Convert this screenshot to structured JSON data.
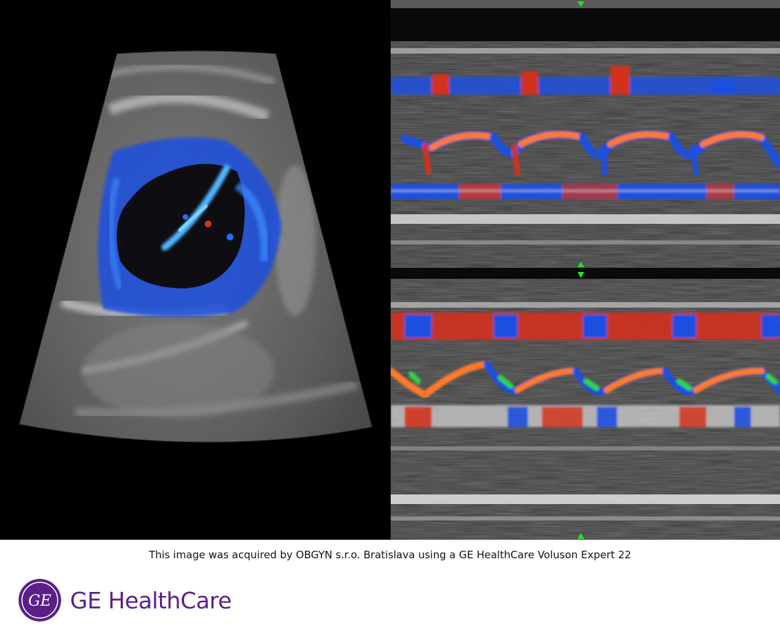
{
  "caption": "This image was acquired by OBGYN s.r.o. Bratislava using a GE HealthCare Voluson Expert 22",
  "brand": {
    "name": "GE HealthCare",
    "logo_icon": "ge-monogram-icon",
    "logo_text": "GE",
    "color": "#5b1f8a"
  },
  "colors": {
    "background_scan": "#000000",
    "background_page": "#ffffff",
    "doppler_blue": "#1e4fe0",
    "doppler_red": "#d2321e",
    "doppler_orange": "#ff7a2a",
    "doppler_green": "#2fd44a",
    "marker_green": "#22e02a"
  },
  "markers": {
    "top_marker_icon": "triangle-down-icon",
    "middle_marker_icon": "double-triangle-icon",
    "bottom_marker_icon": "triangle-up-icon"
  }
}
